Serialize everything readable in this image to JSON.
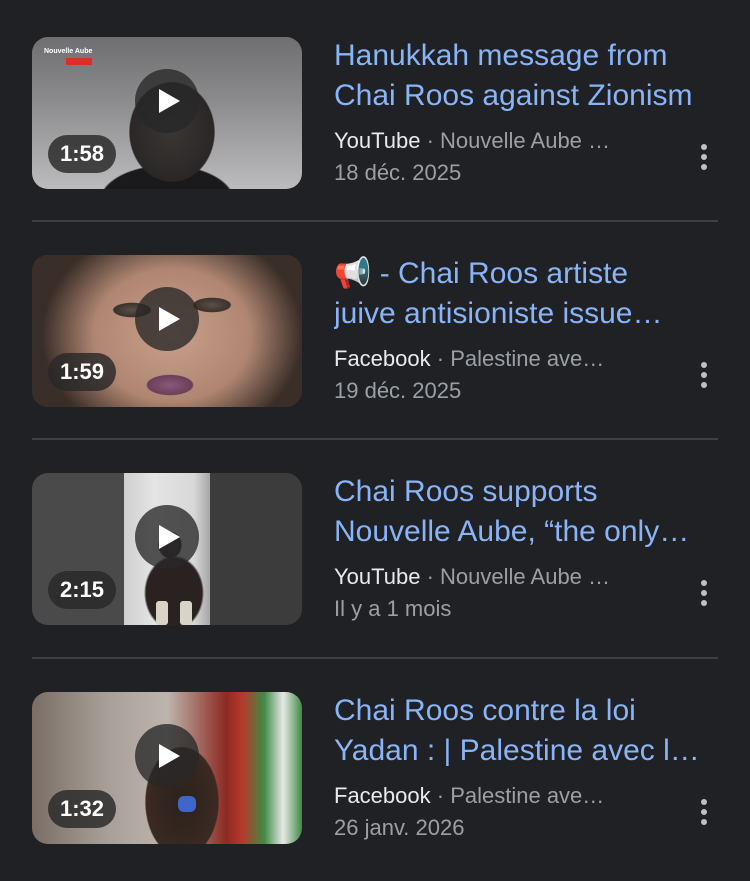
{
  "results": [
    {
      "title_line1": "Hanukkah message from",
      "title_line2": "Chai Roos against Zionism",
      "source": "YouTube",
      "separator": "·",
      "channel": "Nouvelle Aube …",
      "date": "18 déc. 2025",
      "duration": "1:58",
      "thumb_caption": "Nouvelle Aube"
    },
    {
      "title_line1": "📢 - Chai Roos artiste",
      "title_line2": "juive antisioniste issue…",
      "source": "Facebook",
      "separator": "·",
      "channel": "Palestine ave…",
      "date": "19 déc. 2025",
      "duration": "1:59"
    },
    {
      "title_line1": "Chai Roos supports",
      "title_line2": "Nouvelle Aube, “the only…",
      "source": "YouTube",
      "separator": "·",
      "channel": "Nouvelle Aube …",
      "date": "Il y a 1 mois",
      "duration": "2:15"
    },
    {
      "title_line1": "Chai Roos contre la loi",
      "title_line2": "Yadan : | Palestine avec l…",
      "source": "Facebook",
      "separator": "·",
      "channel": "Palestine ave…",
      "date": "26 janv. 2026",
      "duration": "1:32"
    }
  ],
  "colors": {
    "background": "#202124",
    "title": "#8ab4f8",
    "source": "#e8eaed",
    "secondary": "#9aa0a6",
    "divider": "#3c4043"
  },
  "icons": {
    "play": "play-icon",
    "more": "more-vert-icon"
  }
}
